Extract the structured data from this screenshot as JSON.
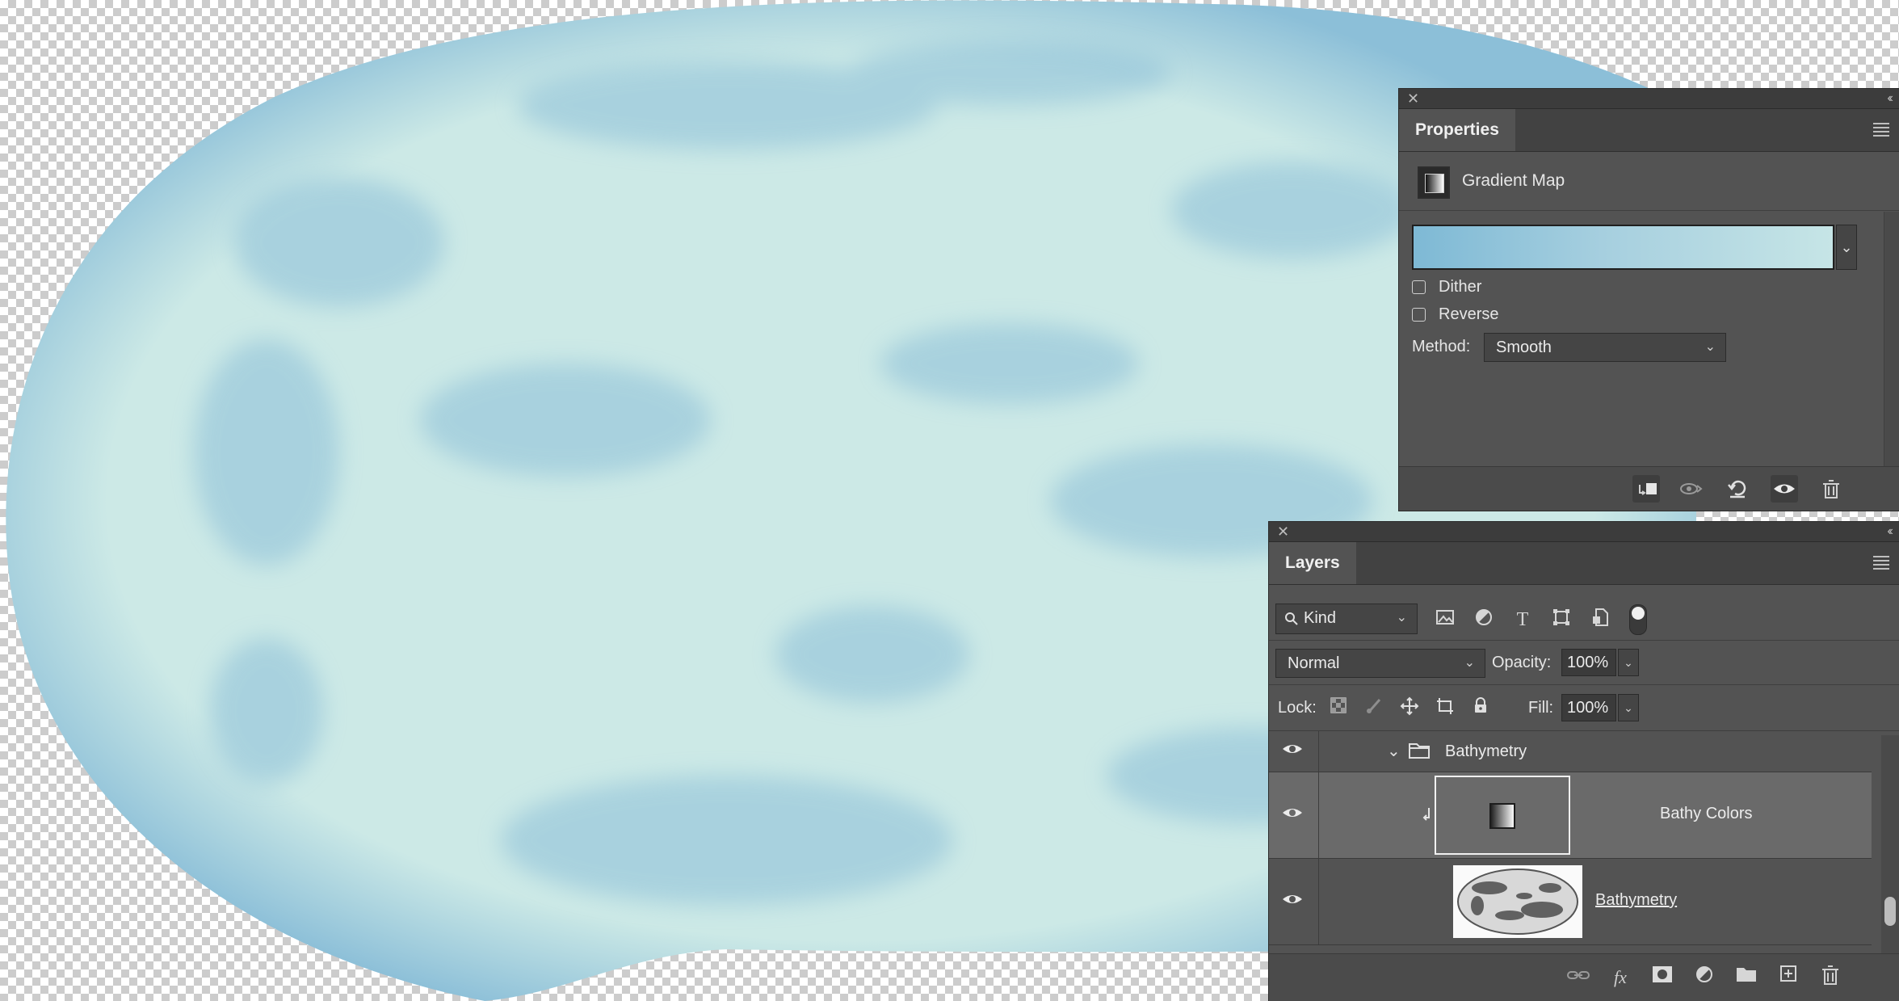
{
  "properties_panel": {
    "close_glyph": "✕",
    "collapse_glyph": "‹‹",
    "tab_label": "Properties",
    "adjustment_name": "Gradient Map",
    "gradient_colors": [
      "#7eb9d5",
      "#c6e5e6"
    ],
    "dither_label": "Dither",
    "dither_checked": false,
    "reverse_label": "Reverse",
    "reverse_checked": false,
    "method_label": "Method:",
    "method_value": "Smooth",
    "footer_icons": [
      "clip-to-layer-icon",
      "view-previous-state-icon",
      "reset-icon",
      "visibility-icon",
      "trash-icon"
    ]
  },
  "layers_panel": {
    "close_glyph": "✕",
    "collapse_glyph": "‹‹",
    "tab_label": "Layers",
    "filter_kind": "Kind",
    "filter_icons": [
      "image-filter-icon",
      "adjustment-filter-icon",
      "type-filter-icon",
      "shape-filter-icon",
      "smart-object-filter-icon"
    ],
    "blend_mode": "Normal",
    "opacity_label": "Opacity:",
    "opacity_value": "100%",
    "lock_label": "Lock:",
    "lock_icons": [
      "lock-transparent-icon",
      "lock-image-icon",
      "lock-position-icon",
      "lock-artboard-icon",
      "lock-all-icon"
    ],
    "fill_label": "Fill:",
    "fill_value": "100%",
    "layers": [
      {
        "name": "Bathymetry",
        "type": "group",
        "visible": true,
        "expanded": true
      },
      {
        "name": "Bathy Colors",
        "type": "gradient-map",
        "visible": true,
        "selected": true,
        "clipped": true
      },
      {
        "name": "Bathymetry",
        "type": "pixel",
        "visible": true
      }
    ],
    "footer_icons": [
      "link-layers-icon",
      "fx-icon",
      "add-mask-icon",
      "new-adjustment-icon",
      "new-group-icon",
      "new-layer-icon",
      "trash-icon"
    ],
    "fx_glyph": "fx"
  },
  "canvas": {
    "ocean_light": "#cce9e6",
    "ocean_dark": "#8cbfd8"
  }
}
